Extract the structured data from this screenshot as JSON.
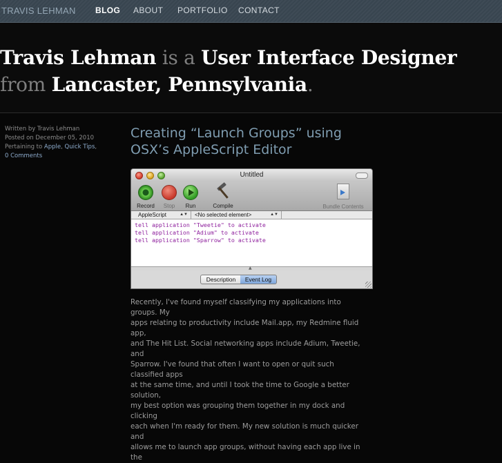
{
  "site": {
    "brand": "TRAVIS LEHMAN",
    "nav": [
      {
        "label": "BLOG",
        "active": true
      },
      {
        "label": "ABOUT",
        "active": false
      },
      {
        "label": "PORTFOLIO",
        "active": false
      },
      {
        "label": "CONTACT",
        "active": false
      }
    ]
  },
  "hero": {
    "name": "Travis Lehman",
    "is_a": "is a",
    "role": "User Interface Designer",
    "from": "from",
    "location": "Lancaster, Pennsylvania",
    "dot": "."
  },
  "meta": {
    "written_by": "Written by Travis Lehman",
    "posted_on": "Posted on December 05, 2010",
    "pertaining": "Pertaining to",
    "categories": [
      "Apple",
      "Quick Tips"
    ],
    "comments": "0 Comments"
  },
  "post": {
    "title_line1": "Creating “Launch Groups” using",
    "title_line2": "OSX’s AppleScript Editor",
    "paragraph": [
      "Recently, I've found myself classifying my applications into groups. My",
      "apps relating to productivity include Mail.app, my Redmine fluid app,",
      "and The Hit List. Social networking apps include Adium, Tweetie, and",
      "Sparrow. I've found that often I want to open or quit such classified apps",
      "at the same time, and until I took the time to Google a better solution,",
      "my best option was grouping them together in my dock and clicking",
      "each when I'm ready for them. My new solution is much quicker and",
      "allows me to launch app groups, without having each app live in the"
    ]
  },
  "window": {
    "title": "Untitled",
    "toolbar": {
      "record": "Record",
      "stop": "Stop",
      "run": "Run",
      "compile": "Compile",
      "bundle": "Bundle Contents"
    },
    "language_select": "AppleScript",
    "element_select": "<No selected element>",
    "code": [
      "tell application \"Tweetie\" to activate",
      "tell application \"Adium\" to activate",
      "tell application \"Sparrow\" to activate"
    ],
    "tabs": {
      "description": "Description",
      "event_log": "Event Log"
    }
  }
}
